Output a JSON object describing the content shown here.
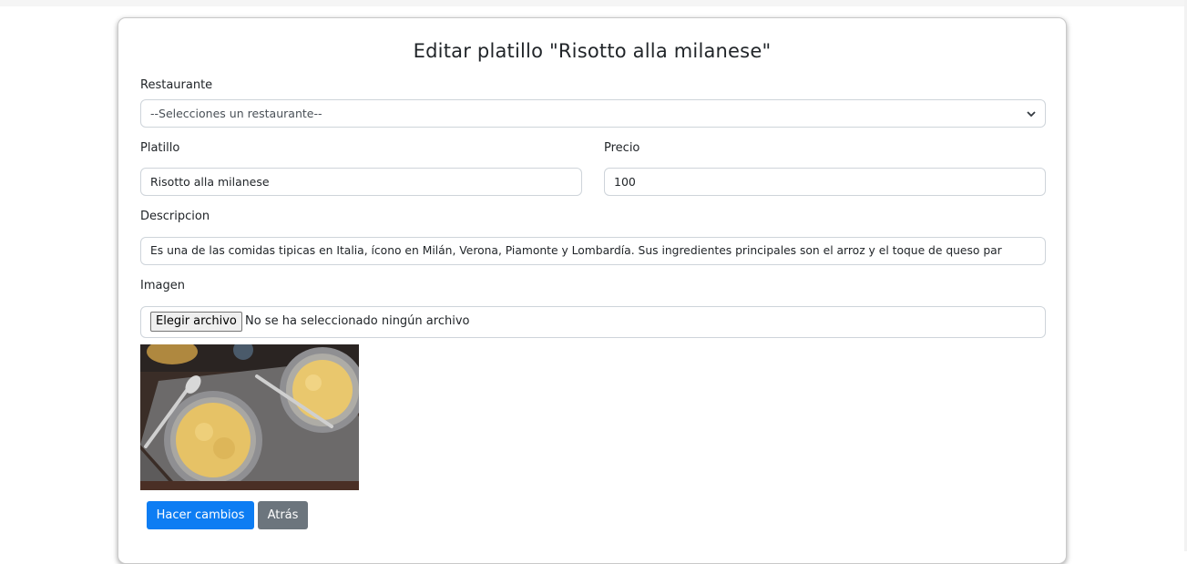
{
  "form": {
    "title": "Editar platillo \"Risotto alla milanese\"",
    "restaurante": {
      "label": "Restaurante",
      "selected": "--Selecciones un restaurante--"
    },
    "platillo": {
      "label": "Platillo",
      "value": "Risotto alla milanese"
    },
    "precio": {
      "label": "Precio",
      "value": "100"
    },
    "descripcion": {
      "label": "Descripcion",
      "value": "Es una de las comidas tipicas en Italia, ícono en Milán, Verona, Piamonte y Lombardía. Sus ingredientes principales son el arroz y el toque de queso par"
    },
    "imagen": {
      "label": "Imagen",
      "choose_label": "Elegir archivo",
      "status": "No se ha seleccionado ningún archivo"
    },
    "buttons": {
      "submit": "Hacer cambios",
      "back": "Atrás"
    }
  },
  "colors": {
    "primary": "#0d7df3",
    "secondary": "#6c757d"
  }
}
